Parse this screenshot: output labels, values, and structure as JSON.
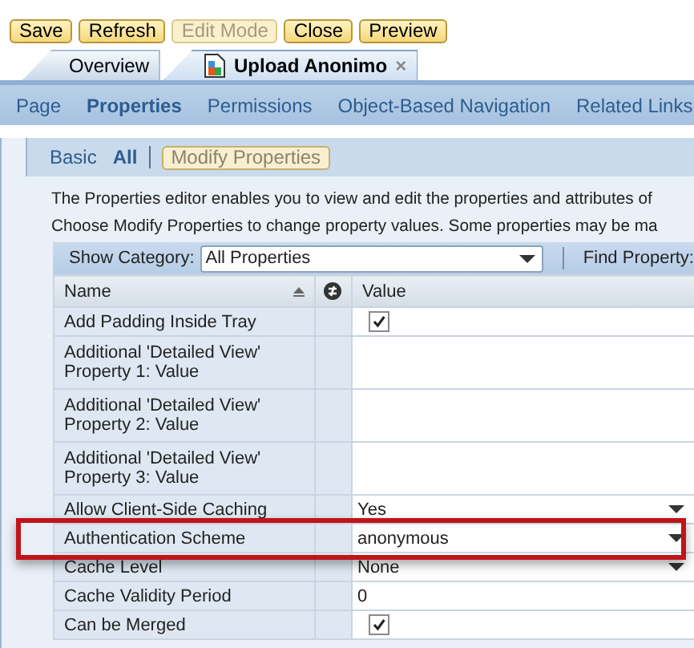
{
  "toolbar": [
    {
      "label": "Save",
      "disabled": false
    },
    {
      "label": "Refresh",
      "disabled": false
    },
    {
      "label": "Edit Mode",
      "disabled": true
    },
    {
      "label": "Close",
      "disabled": false
    },
    {
      "label": "Preview",
      "disabled": false
    }
  ],
  "tabs": [
    {
      "label": "Overview",
      "selected": false,
      "closable": false
    },
    {
      "label": "Upload Anonimo",
      "selected": true,
      "closable": true,
      "close": "×"
    }
  ],
  "nav": [
    {
      "label": "Page",
      "selected": false
    },
    {
      "label": "Properties",
      "selected": true
    },
    {
      "label": "Permissions",
      "selected": false
    },
    {
      "label": "Object-Based Navigation",
      "selected": false
    },
    {
      "label": "Related Links",
      "selected": false
    }
  ],
  "subnav": {
    "items": [
      {
        "label": "Basic",
        "selected": false
      },
      {
        "label": "All",
        "selected": true
      }
    ],
    "button": {
      "label": "Modify Properties",
      "disabled": true
    }
  },
  "description": [
    "The Properties editor enables you to view and edit the properties and attributes of",
    "Choose Modify Properties to change property values. Some properties may be ma"
  ],
  "filter": {
    "category_label": "Show Category:",
    "category_value": "All Properties",
    "find_label": "Find Property:"
  },
  "table": {
    "columns": [
      "Name",
      "Value"
    ],
    "rows": [
      {
        "name": "Add Padding Inside Tray",
        "kind": "checkbox",
        "checked": true,
        "highlighted": false
      },
      {
        "name": "Additional 'Detailed View' Property 1: Value",
        "kind": "text",
        "value": "",
        "highlighted": false
      },
      {
        "name": "Additional 'Detailed View' Property 2: Value",
        "kind": "text",
        "value": "",
        "highlighted": false
      },
      {
        "name": "Additional 'Detailed View' Property 3: Value",
        "kind": "text",
        "value": "",
        "highlighted": false
      },
      {
        "name": "Allow Client-Side Caching",
        "kind": "dropdown",
        "value": "Yes",
        "highlighted": false
      },
      {
        "name": "Authentication Scheme",
        "kind": "dropdown",
        "value": "anonymous",
        "highlighted": true
      },
      {
        "name": "Cache Level",
        "kind": "dropdown",
        "value": "None",
        "highlighted": false
      },
      {
        "name": "Cache Validity Period",
        "kind": "text",
        "value": "0",
        "highlighted": false
      },
      {
        "name": "Can be Merged",
        "kind": "checkbox",
        "checked": true,
        "highlighted": false
      }
    ]
  }
}
